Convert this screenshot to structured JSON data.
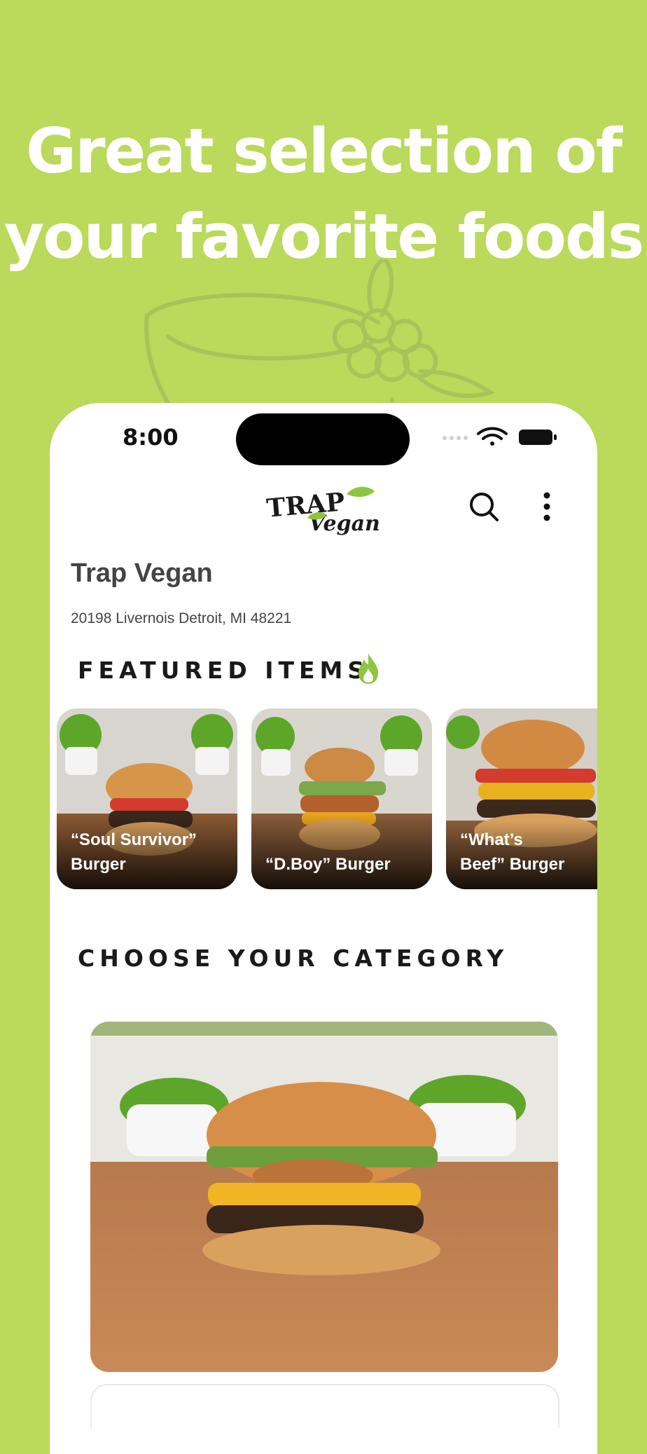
{
  "headline": {
    "line1": "Great selection of",
    "line2": "your favorite foods"
  },
  "colors": {
    "background": "#bbd95a",
    "accent": "#8cc63f",
    "text_dark": "#1a1a1a"
  },
  "status_bar": {
    "time": "8:00",
    "icons": [
      "wifi-icon",
      "battery-icon"
    ]
  },
  "app_header": {
    "logo_text_top": "TRAP",
    "logo_text_bottom": "Vegan",
    "icons": [
      "search-icon",
      "more-vertical-icon"
    ]
  },
  "restaurant": {
    "name": "Trap Vegan",
    "address": "20198 Livernois Detroit, MI 48221"
  },
  "featured": {
    "title": "FEATURED ITEMS",
    "icon": "flame-icon",
    "items": [
      {
        "label": "“Soul Survivor”\nBurger"
      },
      {
        "label": "“D.Boy” Burger"
      },
      {
        "label": "“What’s\nBeef” Burger"
      }
    ]
  },
  "category": {
    "title": "CHOOSE YOUR CATEGORY"
  }
}
